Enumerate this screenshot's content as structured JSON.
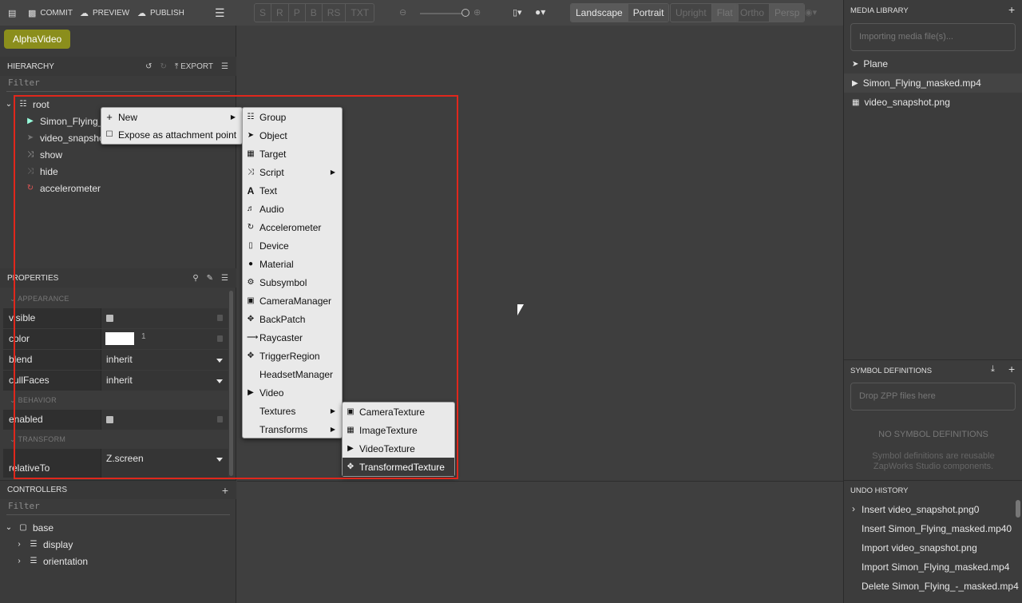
{
  "toolbar": {
    "commit": "COMMIT",
    "preview": "PREVIEW",
    "publish": "PUBLISH",
    "modes": [
      "S",
      "R",
      "P",
      "B",
      "RS",
      "TXT"
    ],
    "orientation": [
      "Landscape",
      "Portrait"
    ],
    "view_upright": "Upright",
    "view_flat": "Flat",
    "projection": [
      "Ortho",
      "Persp"
    ]
  },
  "project_name": "AlphaVideo",
  "hierarchy": {
    "title": "HIERARCHY",
    "export_label": "EXPORT",
    "filter_placeholder": "Filter",
    "items": [
      {
        "label": "root",
        "icon": "sitemap-icon"
      },
      {
        "label": "Simon_Flying_m",
        "icon": "video-icon"
      },
      {
        "label": "video_snapshot",
        "icon": "rocket-icon"
      },
      {
        "label": "show",
        "icon": "shuffle-icon"
      },
      {
        "label": "hide",
        "icon": "shuffle-icon"
      },
      {
        "label": "accelerometer",
        "icon": "refresh-icon"
      }
    ]
  },
  "properties": {
    "title": "PROPERTIES",
    "sections": {
      "appearance": "APPEARANCE",
      "behavior": "BEHAVIOR",
      "transform": "TRANSFORM"
    },
    "visible_label": "visible",
    "color_label": "color",
    "color_value": "1",
    "blend_label": "blend",
    "blend_value": "inherit",
    "cullfaces_label": "cullFaces",
    "cullfaces_value": "inherit",
    "enabled_label": "enabled",
    "relativeto_label": "relativeTo",
    "relativeto_value": "Z.screen"
  },
  "controllers": {
    "title": "CONTROLLERS",
    "filter_placeholder": "Filter",
    "items": [
      {
        "label": "base"
      },
      {
        "label": "display"
      },
      {
        "label": "orientation"
      }
    ]
  },
  "context_menu": {
    "new_label": "New",
    "expose_label": "Expose as attachment point"
  },
  "new_submenu": {
    "items": [
      {
        "label": "Group",
        "icon": "sitemap-icon"
      },
      {
        "label": "Object",
        "icon": "rocket-icon"
      },
      {
        "label": "Target",
        "icon": "image-icon"
      },
      {
        "label": "Script",
        "icon": "shuffle-icon"
      },
      {
        "label": "Text",
        "icon": "font-icon"
      },
      {
        "label": "Audio",
        "icon": "volume-icon"
      },
      {
        "label": "Accelerometer",
        "icon": "refresh-icon"
      },
      {
        "label": "Device",
        "icon": "mobile-icon"
      },
      {
        "label": "Material",
        "icon": "droplet-icon"
      },
      {
        "label": "Subsymbol",
        "icon": "cog-icon"
      },
      {
        "label": "CameraManager",
        "icon": "camera-icon"
      },
      {
        "label": "BackPatch",
        "icon": "move-icon"
      },
      {
        "label": "Raycaster",
        "icon": "arrow-right-icon"
      },
      {
        "label": "TriggerRegion",
        "icon": "move-icon"
      },
      {
        "label": "HeadsetManager",
        "icon": ""
      },
      {
        "label": "Video",
        "icon": "video-icon"
      },
      {
        "label": "Textures",
        "icon": ""
      },
      {
        "label": "Transforms",
        "icon": ""
      }
    ]
  },
  "textures_submenu": {
    "items": [
      {
        "label": "CameraTexture",
        "icon": "video-camera-icon"
      },
      {
        "label": "ImageTexture",
        "icon": "image-icon"
      },
      {
        "label": "VideoTexture",
        "icon": "video-icon"
      },
      {
        "label": "TransformedTexture",
        "icon": "move-icon"
      }
    ]
  },
  "media_library": {
    "title": "MEDIA LIBRARY",
    "importing": "Importing media file(s)...",
    "items": [
      {
        "label": "Plane",
        "icon": "rocket-icon"
      },
      {
        "label": "Simon_Flying_masked.mp4",
        "icon": "video-icon"
      },
      {
        "label": "video_snapshot.png",
        "icon": "image-icon"
      }
    ]
  },
  "symbol_definitions": {
    "title": "SYMBOL DEFINITIONS",
    "drop_hint": "Drop ZPP files here",
    "empty_title": "NO SYMBOL DEFINITIONS",
    "empty_desc_1": "Symbol definitions are reusable",
    "empty_desc_2": "ZapWorks Studio components."
  },
  "undo_history": {
    "title": "UNDO HISTORY",
    "items": [
      "Insert video_snapshot.png0",
      "Insert Simon_Flying_masked.mp40",
      "Import video_snapshot.png",
      "Import Simon_Flying_masked.mp4",
      "Delete Simon_Flying_-_masked.mp4"
    ]
  },
  "colors": {
    "accent_project": "#8b8e1c",
    "highlight_box": "#e0271c"
  }
}
